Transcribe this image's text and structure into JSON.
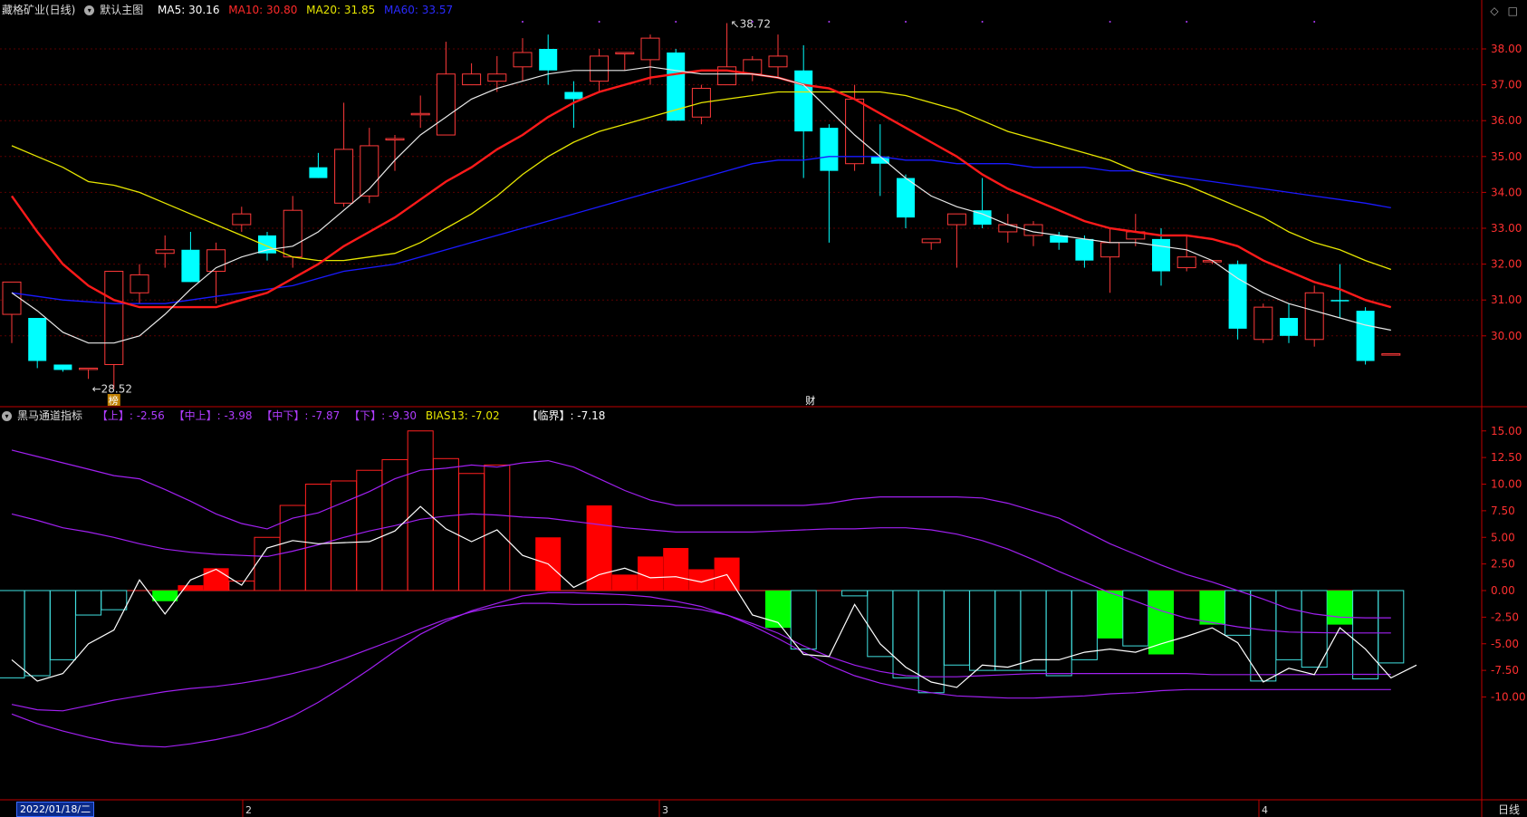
{
  "header": {
    "stock": "藏格矿业(日线)",
    "main_chart_name": "默认主图",
    "ma": [
      {
        "label": "MA5: 30.16",
        "color": "#ffffff"
      },
      {
        "label": "MA10: 30.80",
        "color": "#ff2a2a"
      },
      {
        "label": "MA20: 31.85",
        "color": "#e6e600"
      },
      {
        "label": "MA60: 33.57",
        "color": "#1a1aff"
      }
    ],
    "icons": [
      "diamond-icon",
      "square-icon"
    ]
  },
  "indicator_header": {
    "name": "黑马通道指标",
    "items": [
      {
        "label": "【上】: -2.56",
        "color": "#b03cff"
      },
      {
        "label": "【中上】: -3.98",
        "color": "#b03cff"
      },
      {
        "label": "【中下】: -7.87",
        "color": "#b03cff"
      },
      {
        "label": "【下】: -9.30",
        "color": "#b03cff"
      },
      {
        "label": "BIAS13: -7.02",
        "color": "#e6e600"
      },
      {
        "label": "【临界】: -7.18",
        "color": "#ffffff"
      }
    ]
  },
  "footer": {
    "date_label": "2022/01/18/二",
    "month_ticks": [
      "2",
      "3",
      "4"
    ],
    "period_label": "日线"
  },
  "chart_data": [
    {
      "type": "candlestick",
      "ylim": [
        28.6,
        38.6
      ],
      "yticks": [
        "38.00",
        "37.00",
        "36.00",
        "35.00",
        "34.00",
        "33.00",
        "32.00",
        "31.00",
        "30.00"
      ],
      "annotations": {
        "high": "38.72",
        "low": "28.52",
        "badge_low": "榜",
        "badge_mid": "财"
      },
      "candles": [
        [
          30.6,
          31.5,
          29.8,
          31.3
        ],
        [
          30.5,
          29.3,
          29.1,
          29.9
        ],
        [
          29.2,
          29.05,
          29.0,
          29.2
        ],
        [
          29.1,
          29.1,
          28.8,
          29.1
        ],
        [
          29.2,
          31.8,
          28.52,
          31.7
        ],
        [
          31.2,
          31.7,
          30.9,
          32.0
        ],
        [
          32.3,
          32.4,
          31.9,
          32.8
        ],
        [
          32.4,
          31.5,
          31.5,
          32.9
        ],
        [
          31.8,
          32.4,
          30.9,
          32.6
        ],
        [
          33.1,
          33.4,
          32.9,
          33.6
        ],
        [
          32.8,
          32.3,
          32.1,
          32.9
        ],
        [
          32.2,
          33.5,
          31.9,
          33.9
        ],
        [
          34.7,
          34.4,
          34.4,
          35.1
        ],
        [
          33.7,
          35.2,
          33.6,
          36.5
        ],
        [
          33.9,
          35.3,
          33.7,
          35.8
        ],
        [
          35.5,
          35.5,
          34.6,
          35.6
        ],
        [
          36.2,
          36.2,
          35.8,
          36.7
        ],
        [
          35.6,
          37.3,
          35.6,
          38.2
        ],
        [
          37.0,
          37.3,
          37.0,
          37.6
        ],
        [
          37.1,
          37.3,
          36.8,
          37.8
        ],
        [
          37.5,
          37.9,
          37.1,
          38.3
        ],
        [
          38.0,
          37.4,
          37.0,
          38.4
        ],
        [
          36.8,
          36.6,
          35.8,
          37.1
        ],
        [
          37.1,
          37.8,
          36.8,
          38.0
        ],
        [
          37.9,
          37.9,
          37.4,
          37.9
        ],
        [
          37.7,
          38.3,
          37.0,
          38.4
        ],
        [
          37.9,
          36.0,
          36.0,
          38.0
        ],
        [
          36.1,
          36.9,
          35.9,
          37.0
        ],
        [
          37.0,
          37.5,
          37.0,
          38.72
        ],
        [
          37.3,
          37.7,
          37.1,
          37.8
        ],
        [
          37.5,
          37.8,
          37.2,
          38.4
        ],
        [
          37.4,
          35.7,
          34.4,
          38.1
        ],
        [
          35.8,
          34.6,
          32.6,
          35.9
        ],
        [
          34.8,
          36.6,
          34.6,
          37.0
        ],
        [
          35.0,
          34.8,
          33.9,
          35.9
        ],
        [
          34.4,
          33.3,
          33.0,
          34.5
        ],
        [
          32.6,
          32.7,
          32.4,
          32.7
        ],
        [
          33.1,
          33.4,
          31.9,
          33.4
        ],
        [
          33.5,
          33.1,
          33.0,
          34.4
        ],
        [
          32.9,
          33.1,
          32.6,
          33.4
        ],
        [
          32.8,
          33.1,
          32.5,
          33.2
        ],
        [
          32.8,
          32.6,
          32.4,
          32.9
        ],
        [
          32.7,
          32.1,
          31.9,
          32.8
        ],
        [
          32.2,
          32.6,
          31.2,
          33.0
        ],
        [
          32.7,
          32.9,
          32.5,
          33.4
        ],
        [
          32.7,
          31.8,
          31.4,
          33.0
        ],
        [
          31.9,
          32.2,
          31.8,
          32.8
        ],
        [
          32.1,
          32.1,
          32.0,
          32.1
        ],
        [
          32.0,
          30.2,
          29.9,
          32.1
        ],
        [
          29.9,
          30.8,
          29.8,
          30.9
        ],
        [
          30.5,
          30.0,
          29.8,
          30.9
        ],
        [
          29.9,
          31.2,
          29.7,
          31.4
        ],
        [
          31.0,
          30.99,
          30.5,
          32.0
        ],
        [
          30.7,
          29.3,
          29.2,
          30.8
        ],
        [
          29.5,
          29.5,
          29.5,
          29.5
        ]
      ],
      "ma5": [
        31.2,
        30.7,
        30.1,
        29.8,
        29.8,
        30.0,
        30.6,
        31.3,
        31.9,
        32.2,
        32.4,
        32.5,
        32.9,
        33.5,
        34.1,
        34.9,
        35.6,
        36.1,
        36.6,
        36.9,
        37.1,
        37.3,
        37.4,
        37.4,
        37.4,
        37.5,
        37.4,
        37.3,
        37.3,
        37.3,
        37.2,
        37.0,
        36.3,
        35.6,
        35.0,
        34.4,
        33.9,
        33.6,
        33.4,
        33.1,
        32.9,
        32.8,
        32.7,
        32.6,
        32.6,
        32.5,
        32.4,
        32.1,
        31.6,
        31.2,
        30.9,
        30.7,
        30.5,
        30.3,
        30.16
      ],
      "ma10": [
        33.9,
        32.9,
        32.0,
        31.4,
        31.0,
        30.8,
        30.8,
        30.8,
        30.8,
        31.0,
        31.2,
        31.6,
        32.0,
        32.5,
        32.9,
        33.3,
        33.8,
        34.3,
        34.7,
        35.2,
        35.6,
        36.1,
        36.5,
        36.8,
        37.0,
        37.2,
        37.3,
        37.4,
        37.4,
        37.3,
        37.2,
        37.0,
        36.9,
        36.6,
        36.2,
        35.8,
        35.4,
        35.0,
        34.5,
        34.1,
        33.8,
        33.5,
        33.2,
        33.0,
        32.9,
        32.8,
        32.8,
        32.7,
        32.5,
        32.1,
        31.8,
        31.5,
        31.3,
        31.0,
        30.8
      ],
      "ma20": [
        35.3,
        35.0,
        34.7,
        34.3,
        34.2,
        34.0,
        33.7,
        33.4,
        33.1,
        32.8,
        32.5,
        32.2,
        32.1,
        32.1,
        32.2,
        32.3,
        32.6,
        33.0,
        33.4,
        33.9,
        34.5,
        35.0,
        35.4,
        35.7,
        35.9,
        36.1,
        36.3,
        36.5,
        36.6,
        36.7,
        36.8,
        36.8,
        36.8,
        36.8,
        36.8,
        36.7,
        36.5,
        36.3,
        36.0,
        35.7,
        35.5,
        35.3,
        35.1,
        34.9,
        34.6,
        34.4,
        34.2,
        33.9,
        33.6,
        33.3,
        32.9,
        32.6,
        32.4,
        32.1,
        31.85
      ],
      "ma60": [
        31.2,
        31.1,
        31.0,
        30.95,
        30.9,
        30.9,
        30.9,
        31.0,
        31.1,
        31.2,
        31.3,
        31.4,
        31.6,
        31.8,
        31.9,
        32.0,
        32.2,
        32.4,
        32.6,
        32.8,
        33.0,
        33.2,
        33.4,
        33.6,
        33.8,
        34.0,
        34.2,
        34.4,
        34.6,
        34.8,
        34.9,
        34.9,
        35.0,
        35.0,
        35.0,
        34.9,
        34.9,
        34.8,
        34.8,
        34.8,
        34.7,
        34.7,
        34.7,
        34.6,
        34.6,
        34.5,
        34.4,
        34.3,
        34.2,
        34.1,
        34.0,
        33.9,
        33.8,
        33.7,
        33.57
      ]
    },
    {
      "type": "bar",
      "ylim": [
        -12.0,
        16.5
      ],
      "yticks": [
        "15.00",
        "12.50",
        "10.00",
        "7.50",
        "5.00",
        "2.50",
        "0.00",
        "-2.50",
        "-5.00",
        "-7.50",
        "-10.00"
      ],
      "bias13": [
        -8.2,
        -8.0,
        -6.5,
        -2.3,
        -1.8,
        0.0,
        -1.0,
        0.5,
        2.1,
        0.9,
        5.0,
        8.0,
        10.0,
        10.3,
        11.3,
        12.3,
        15.0,
        12.4,
        11.0,
        11.8,
        0,
        5.0,
        0.0,
        8.0,
        1.5,
        3.2,
        4.0,
        2.0,
        3.1,
        0.0,
        -3.5,
        -5.5,
        0,
        -0.5,
        -6.2,
        -8.2,
        -9.6,
        -7.0,
        -7.5,
        -7.5,
        -7.5,
        -8.0,
        -6.5,
        -4.5,
        -5.2,
        -6.0,
        0,
        -3.2,
        -4.2,
        -8.5,
        -6.5,
        -7.2,
        -3.2,
        -8.3,
        -6.8
      ],
      "white_line": [
        -6.5,
        -8.5,
        -7.8,
        -5.0,
        -3.7,
        1.0,
        -2.2,
        1.0,
        2.0,
        0.5,
        4.0,
        4.7,
        4.4,
        4.5,
        4.6,
        5.6,
        7.9,
        5.8,
        4.6,
        5.7,
        3.3,
        2.5,
        0.3,
        1.5,
        2.1,
        1.2,
        1.3,
        0.8,
        1.5,
        -2.3,
        -3.0,
        -6.0,
        -6.2,
        -1.3,
        -5.0,
        -7.2,
        -8.6,
        -9.1,
        -7.0,
        -7.2,
        -6.5,
        -6.5,
        -5.8,
        -5.5,
        -5.8,
        -5.0,
        -4.3,
        -3.5,
        -4.9,
        -8.6,
        -7.3,
        -7.9,
        -3.5,
        -5.5,
        -8.2,
        -7.0
      ],
      "upper": [
        13.2,
        12.6,
        12.0,
        11.4,
        10.8,
        10.5,
        9.5,
        8.4,
        7.2,
        6.3,
        5.8,
        6.8,
        7.3,
        8.3,
        9.3,
        10.5,
        11.3,
        11.5,
        11.8,
        11.6,
        12.0,
        12.2,
        11.6,
        10.5,
        9.4,
        8.5,
        8.0,
        8.0,
        8.0,
        8.0,
        8.0,
        8.0,
        8.2,
        8.6,
        8.8,
        8.8,
        8.8,
        8.8,
        8.7,
        8.2,
        7.5,
        6.8,
        5.6,
        4.4,
        3.4,
        2.4,
        1.5,
        0.8,
        0.0,
        -0.8,
        -1.7,
        -2.2,
        -2.5,
        -2.56,
        -2.56
      ],
      "mid_upper": [
        7.2,
        6.6,
        5.9,
        5.5,
        5.0,
        4.4,
        3.9,
        3.6,
        3.4,
        3.3,
        3.2,
        3.7,
        4.3,
        5.0,
        5.6,
        6.1,
        6.7,
        7.0,
        7.2,
        7.1,
        6.9,
        6.8,
        6.5,
        6.2,
        5.9,
        5.7,
        5.5,
        5.5,
        5.5,
        5.5,
        5.6,
        5.7,
        5.8,
        5.8,
        5.9,
        5.9,
        5.7,
        5.3,
        4.7,
        3.9,
        2.9,
        1.8,
        0.8,
        -0.2,
        -1.0,
        -1.9,
        -2.6,
        -3.0,
        -3.4,
        -3.7,
        -3.9,
        -3.95,
        -3.98,
        -3.98,
        -3.98
      ],
      "mid_lower": [
        -10.7,
        -11.2,
        -11.3,
        -10.8,
        -10.3,
        -9.9,
        -9.5,
        -9.2,
        -9.0,
        -8.7,
        -8.3,
        -7.8,
        -7.2,
        -6.4,
        -5.5,
        -4.6,
        -3.6,
        -2.7,
        -2.0,
        -1.5,
        -1.2,
        -1.2,
        -1.3,
        -1.3,
        -1.3,
        -1.4,
        -1.5,
        -1.8,
        -2.3,
        -3.1,
        -4.0,
        -5.2,
        -6.2,
        -7.0,
        -7.6,
        -8.0,
        -8.1,
        -8.1,
        -8.0,
        -7.9,
        -7.8,
        -7.8,
        -7.8,
        -7.8,
        -7.8,
        -7.8,
        -7.8,
        -7.9,
        -7.9,
        -7.9,
        -7.9,
        -7.9,
        -7.87,
        -7.87,
        -7.87
      ],
      "lower": [
        -11.6,
        -12.5,
        -13.2,
        -13.8,
        -14.3,
        -14.6,
        -14.7,
        -14.4,
        -14.0,
        -13.5,
        -12.8,
        -11.8,
        -10.5,
        -9.0,
        -7.4,
        -5.7,
        -4.1,
        -2.9,
        -1.9,
        -1.2,
        -0.5,
        -0.2,
        -0.2,
        -0.3,
        -0.4,
        -0.6,
        -1.0,
        -1.5,
        -2.3,
        -3.3,
        -4.5,
        -5.8,
        -7.0,
        -8.0,
        -8.7,
        -9.2,
        -9.6,
        -9.9,
        -10.0,
        -10.1,
        -10.1,
        -10.0,
        -9.9,
        -9.7,
        -9.6,
        -9.4,
        -9.3,
        -9.3,
        -9.3,
        -9.3,
        -9.3,
        -9.3,
        -9.3,
        -9.3,
        -9.3
      ]
    }
  ]
}
